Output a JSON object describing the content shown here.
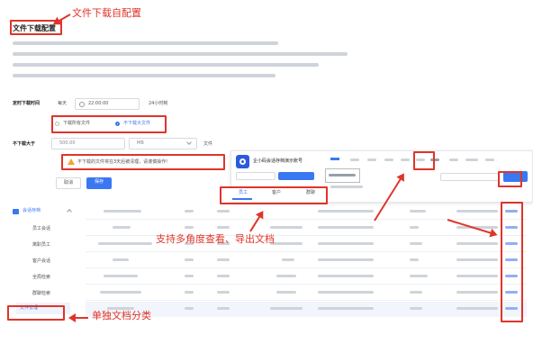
{
  "section": {
    "title": "文件下载配置",
    "time_label": "定时下载时间",
    "time_prefix": "每天",
    "time_value": "22:00:00",
    "time_suffix": "24小时制",
    "scope_all": "下载所有文件",
    "scope_none": "不下载大文件",
    "size_label": "不下载大于",
    "size_value": "500.00",
    "size_unit": "MB",
    "size_suffix": "文件",
    "warning": "不下载的文件将在3天后被清理，请谨慎操作!",
    "cancel_label": "取消",
    "save_label": "保存"
  },
  "sidebar": {
    "group_label": "会话存档",
    "items": [
      "员工会话",
      "离职员工",
      "客户会话",
      "全局检索",
      "群聊检索",
      "文件管理"
    ]
  },
  "file_panel": {
    "app_title": "企小码会话存档演示账号",
    "tabs": [
      "员工",
      "客户",
      "群聊"
    ]
  },
  "annotations": {
    "config_title": "文件下载自配置",
    "multi_view": "支持多角度查看、导出文档",
    "separate_category": "单独文档分类"
  },
  "colors": {
    "annotation_red": "#e0342a",
    "primary_blue": "#3a78f2",
    "logo_blue": "#2c5be0"
  }
}
